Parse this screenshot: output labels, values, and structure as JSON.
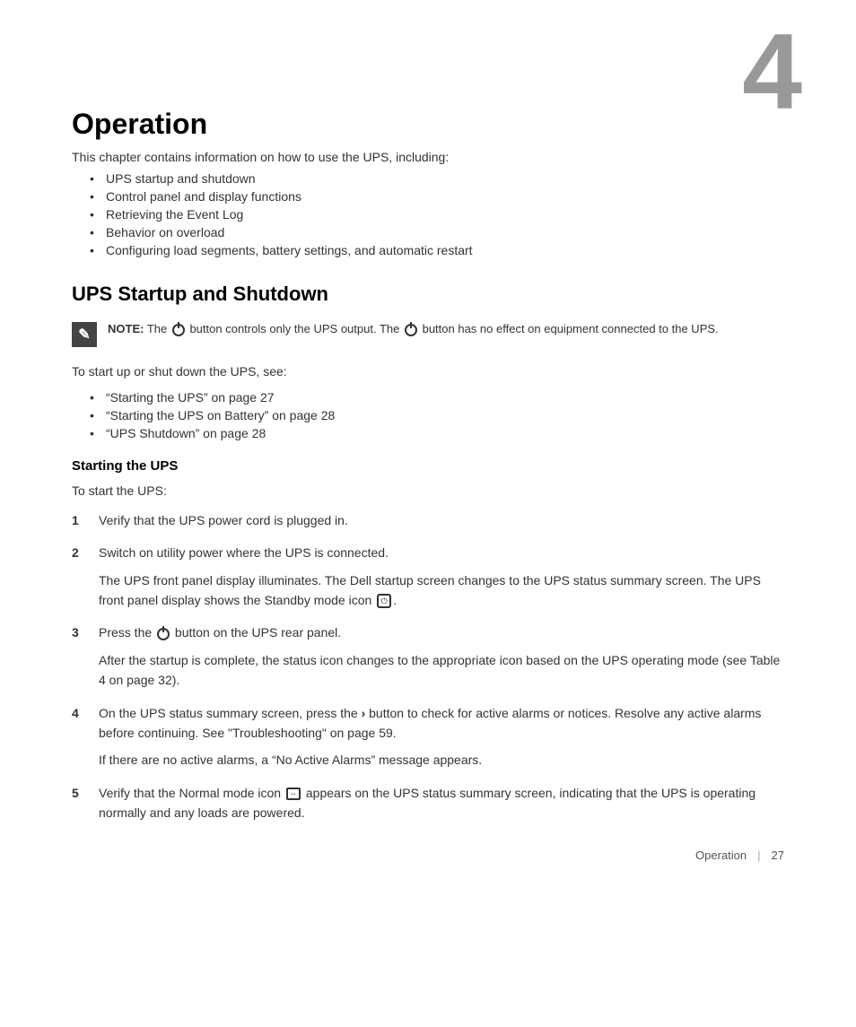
{
  "chapter": {
    "number": "4",
    "title": "Operation",
    "intro": "This chapter contains information on how to use the UPS, including:"
  },
  "bullet_items": [
    "UPS startup and shutdown",
    "Control panel and display functions",
    "Retrieving the Event Log",
    "Behavior on overload",
    "Configuring load segments, battery settings, and automatic restart"
  ],
  "section_startup": {
    "title": "UPS Startup and Shutdown",
    "note_label": "NOTE:",
    "note_text": " The  button controls only the UPS output. The  button has no effect on equipment connected to the UPS.",
    "intro": "To start up or shut down the UPS, see:",
    "links": [
      "“Starting the UPS” on page 27",
      "“Starting the UPS on Battery” on page 28",
      "“UPS Shutdown” on page 28"
    ],
    "sub_section": {
      "title": "Starting the UPS",
      "intro": "To start the UPS:",
      "steps": [
        {
          "number": "1",
          "text": "Verify that the UPS power cord is plugged in."
        },
        {
          "number": "2",
          "text": "Switch on utility power where the UPS is connected.",
          "sub": "The UPS front panel display illuminates. The Dell startup screen changes to the UPS status summary screen. The UPS front panel display shows the Standby mode icon  [icon:standby] ."
        },
        {
          "number": "3",
          "text": "Press the  button on the UPS rear panel.",
          "sub": "After the startup is complete, the status icon changes to the appropriate icon based on the UPS operating mode (see Table 4 on page 32)."
        },
        {
          "number": "4",
          "text": "On the UPS status summary screen, press the › button to check for active alarms or notices. Resolve any active alarms before continuing. See “Troubleshooting” on page 59.",
          "sub": "If there are no active alarms, a “No Active Alarms” message appears."
        },
        {
          "number": "5",
          "text": "Verify that the Normal mode icon  [icon:normal]  appears on the UPS status summary screen, indicating that the UPS is operating normally and any loads are powered."
        }
      ]
    }
  },
  "footer": {
    "label": "Operation",
    "page": "27"
  }
}
